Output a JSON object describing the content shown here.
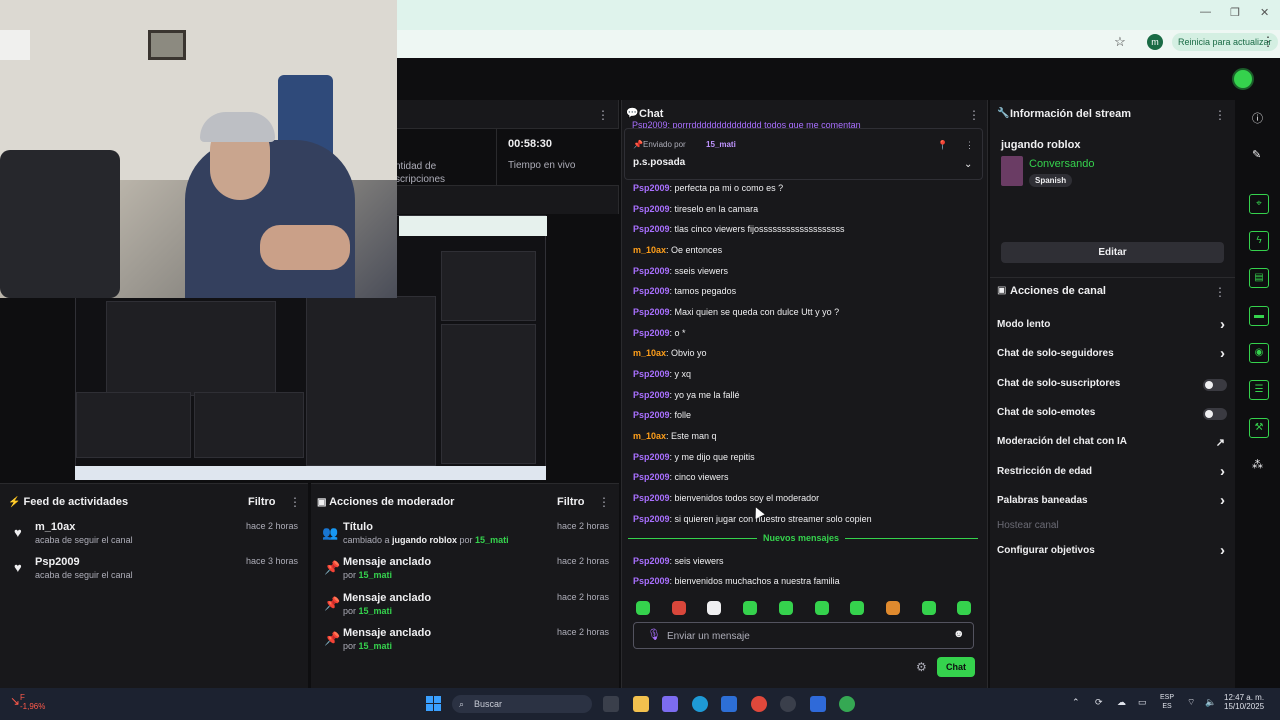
{
  "browser": {
    "restart_label": "Reinicia para actualizar",
    "profile_initial": "m"
  },
  "stream_stats": {
    "left_label_line1": "ntidad de",
    "left_label_line2": "scripciones",
    "time": "00:58:30",
    "time_label": "Tiempo en vivo"
  },
  "feed": {
    "title": "Feed de actividades",
    "filter": "Filtro",
    "items": [
      {
        "name": "m_10ax",
        "sub": "acaba de seguir el canal",
        "time": "hace 2 horas"
      },
      {
        "name": "Psp2009",
        "sub": "acaba de seguir el canal",
        "time": "hace 3 horas"
      }
    ]
  },
  "mod_actions": {
    "title": "Acciones de moderador",
    "filter": "Filtro",
    "items": [
      {
        "name": "Título",
        "sub_pre": "cambiado a ",
        "sub_hl": "jugando roblox",
        "sub_mid": " por ",
        "sub_user": "15_mati",
        "time": "hace 2 horas"
      },
      {
        "name": "Mensaje anclado",
        "sub_pre": "por ",
        "sub_user": "15_mati",
        "time": "hace 2 horas"
      },
      {
        "name": "Mensaje anclado",
        "sub_pre": "por ",
        "sub_user": "15_mati",
        "time": "hace 2 horas"
      },
      {
        "name": "Mensaje anclado",
        "sub_pre": "por ",
        "sub_user": "15_mati",
        "time": "hace 2 horas"
      }
    ]
  },
  "chat": {
    "title": "Chat",
    "pinned_cut": "Psp2009: porrrdddddddddddddd todos que me comentan",
    "pinned_label": "Enviado por",
    "pinned_user": "15_mati",
    "pinned_msg": "p.s.posada",
    "messages": [
      {
        "user": "Psp2009",
        "text": ": perfecta pa mi o como es ?"
      },
      {
        "user": "Psp2009",
        "text": ": tireselo en la camara"
      },
      {
        "user": "Psp2009",
        "text": ": tlas cinco viewers fijosssssssssssssssssss"
      },
      {
        "user": "m_10ax",
        "text": ": Oe entonces"
      },
      {
        "user": "Psp2009",
        "text": ": sseis viewers"
      },
      {
        "user": "Psp2009",
        "text": ": tamos pegados"
      },
      {
        "user": "Psp2009",
        "text": ": Maxi quien se queda con dulce Utt y yo ?"
      },
      {
        "user": "Psp2009",
        "text": ": o *"
      },
      {
        "user": "m_10ax",
        "text": ": Obvio yo"
      },
      {
        "user": "Psp2009",
        "text": ": y xq"
      },
      {
        "user": "Psp2009",
        "text": ": yo ya me la fallé"
      },
      {
        "user": "Psp2009",
        "text": ": folle"
      },
      {
        "user": "m_10ax",
        "text": ": Este man q"
      },
      {
        "user": "Psp2009",
        "text": ": y me dijo que repitis"
      },
      {
        "user": "Psp2009",
        "text": ": cinco viewers"
      },
      {
        "user": "Psp2009",
        "text": ": bienvenidos todos soy el moderador"
      },
      {
        "user": "Psp2009",
        "text": ": si quieren jugar con nuestro streamer solo copien"
      }
    ],
    "new_messages_label": "Nuevos mensajes",
    "new_messages": [
      {
        "user": "Psp2009",
        "text": ": seis viewers"
      },
      {
        "user": "Psp2009",
        "text": ": bienvenidos muchachos a nuestra familia"
      }
    ],
    "input_placeholder": "Enviar un mensaje",
    "send_label": "Chat"
  },
  "stream_info": {
    "title": "Información del stream",
    "stream_title": "jugando roblox",
    "category": "Conversando",
    "language": "Spanish",
    "edit_label": "Editar"
  },
  "channel_actions": {
    "title": "Acciones de canal",
    "items": [
      {
        "label": "Modo lento",
        "control": "chevron"
      },
      {
        "label": "Chat de solo-seguidores",
        "control": "chevron"
      },
      {
        "label": "Chat de solo-suscriptores",
        "control": "toggle"
      },
      {
        "label": "Chat de solo-emotes",
        "control": "toggle"
      },
      {
        "label": "Moderación del chat con IA",
        "control": "external"
      },
      {
        "label": "Restricción de edad",
        "control": "chevron"
      },
      {
        "label": "Palabras baneadas",
        "control": "chevron"
      },
      {
        "label": "Hostear canal",
        "control": "disabled"
      },
      {
        "label": "Configurar objetivos",
        "control": "chevron"
      }
    ]
  },
  "taskbar": {
    "search_placeholder": "Buscar",
    "stock_line1": "F",
    "stock_line2": "-1,96%",
    "lang_line1": "ESP",
    "lang_line2": "ES",
    "clock_time": "12:47 a. m.",
    "clock_date": "15/10/2025"
  },
  "colors": {
    "accent": "#35d24d",
    "username_psp": "#a970ff",
    "username_m10": "#ff9f1a",
    "panel_bg": "#18181b",
    "page_bg": "#0e0e10"
  }
}
